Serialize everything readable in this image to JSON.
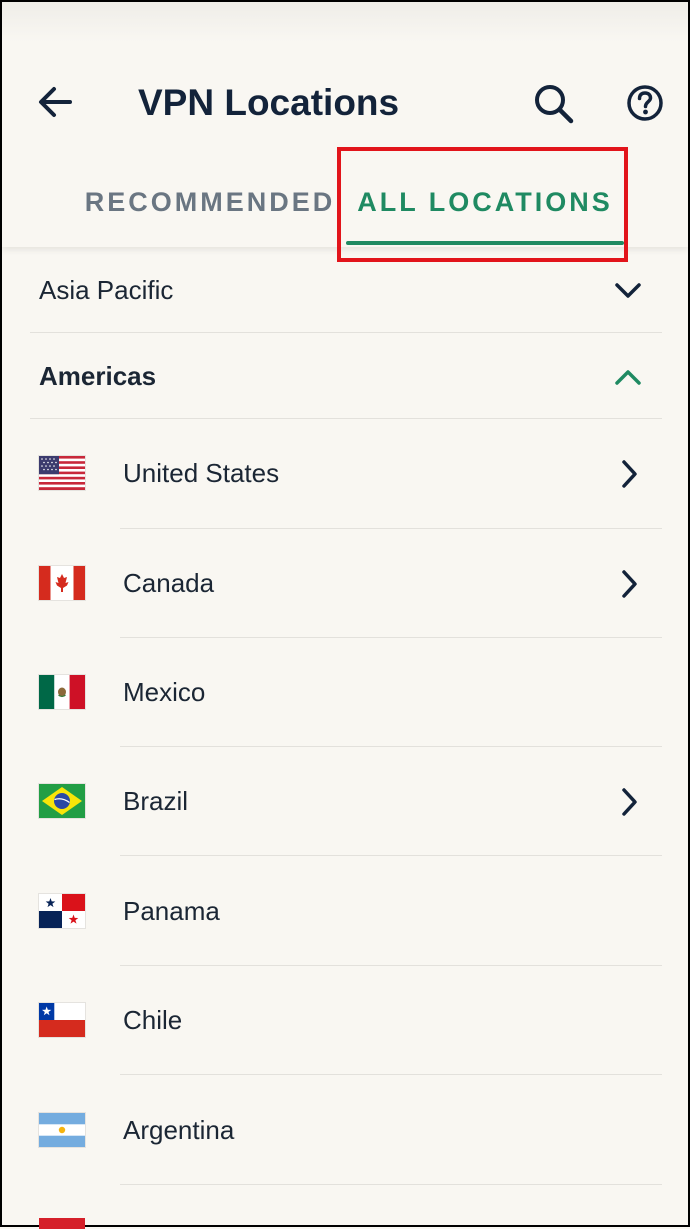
{
  "header": {
    "title": "VPN Locations",
    "back_icon": "arrow-left-icon",
    "search_icon": "search-icon",
    "help_icon": "help-circle-icon"
  },
  "tabs": [
    {
      "label": "RECOMMENDED",
      "active": false
    },
    {
      "label": "ALL LOCATIONS",
      "active": true
    }
  ],
  "regions": [
    {
      "label": "Asia Pacific",
      "expanded": false
    },
    {
      "label": "Americas",
      "expanded": true
    }
  ],
  "countries": [
    {
      "name": "United States",
      "flag": "us-flag-icon",
      "has_chevron": true
    },
    {
      "name": "Canada",
      "flag": "ca-flag-icon",
      "has_chevron": true
    },
    {
      "name": "Mexico",
      "flag": "mx-flag-icon",
      "has_chevron": false
    },
    {
      "name": "Brazil",
      "flag": "br-flag-icon",
      "has_chevron": true
    },
    {
      "name": "Panama",
      "flag": "pa-flag-icon",
      "has_chevron": false
    },
    {
      "name": "Chile",
      "flag": "cl-flag-icon",
      "has_chevron": false
    },
    {
      "name": "Argentina",
      "flag": "ar-flag-icon",
      "has_chevron": false
    }
  ],
  "colors": {
    "accent": "#1f8a62",
    "text": "#13233a",
    "muted": "#6a7682",
    "background": "#f9f7f2",
    "highlight": "#e2141b"
  }
}
